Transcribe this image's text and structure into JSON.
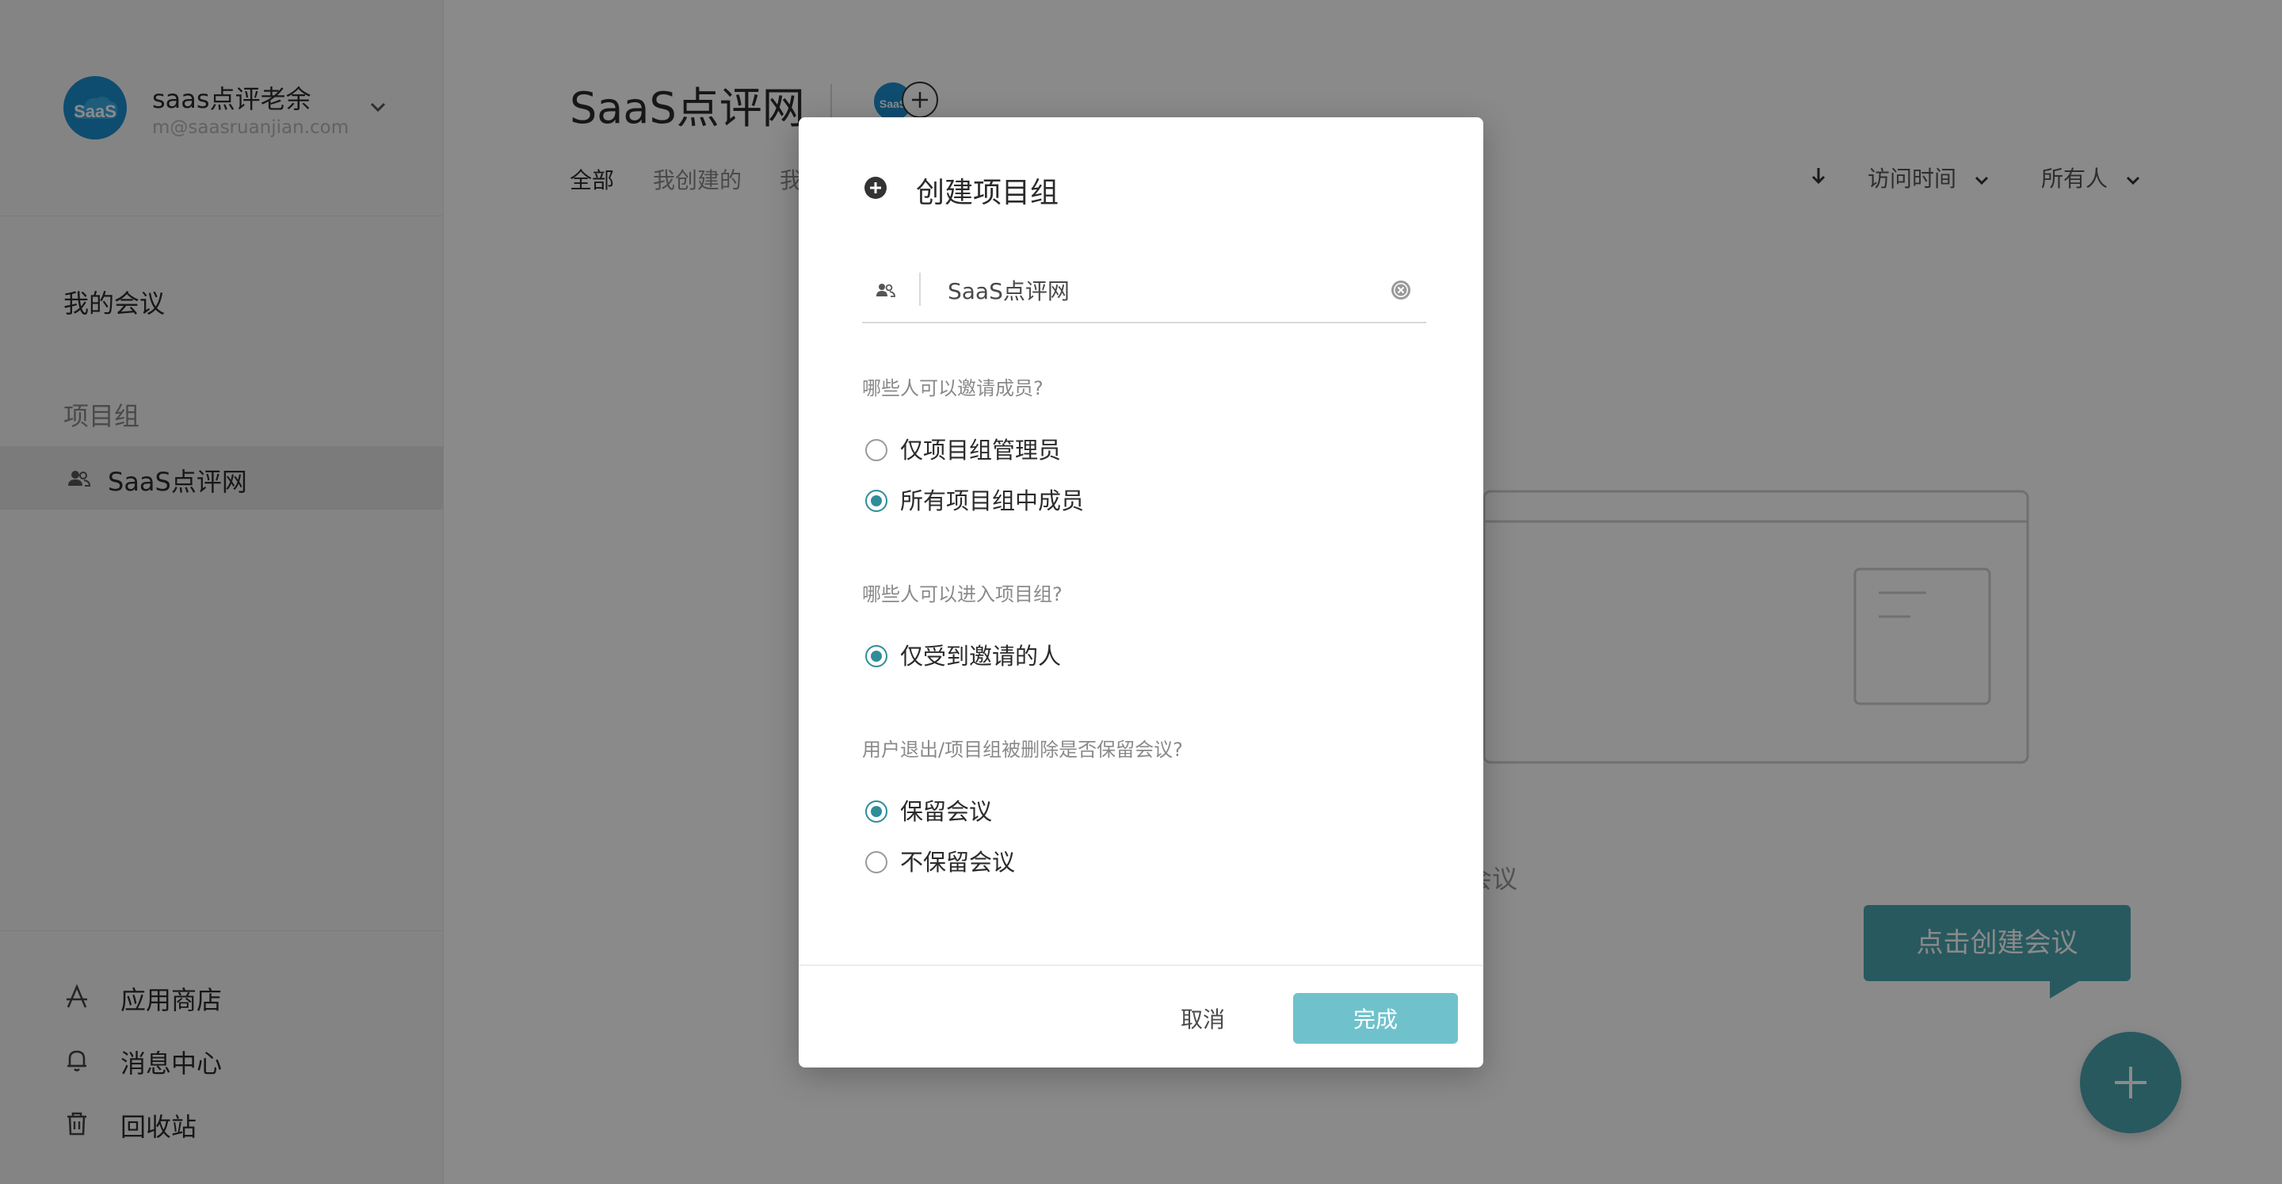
{
  "sidebar": {
    "user": {
      "name": "saas点评老余",
      "email": "m@saasruanjian.com",
      "avatar_text": "SaaS"
    },
    "my_meetings_label": "我的会议",
    "group_section_title": "项目组",
    "group_items": [
      {
        "label": "SaaS点评网",
        "icon": "group-icon"
      }
    ],
    "bottom_items": [
      {
        "label": "应用商店",
        "icon": "app-store-icon"
      },
      {
        "label": "消息中心",
        "icon": "bell-icon"
      },
      {
        "label": "回收站",
        "icon": "trash-icon"
      }
    ]
  },
  "header": {
    "title": "SaaS点评网",
    "badge_text": "SaaS",
    "tabs": [
      {
        "label": "全部",
        "active": true
      },
      {
        "label": "我创建的",
        "active": false
      },
      {
        "label": "我",
        "active": false
      }
    ],
    "sort_icon": "arrow-down-icon",
    "filters": [
      {
        "label": "访问时间"
      },
      {
        "label": "所有人"
      }
    ]
  },
  "main": {
    "empty_text_partial": "会议",
    "tooltip_text": "点击创建会议"
  },
  "modal": {
    "title": "创建项目组",
    "name_input": {
      "value": "SaaS点评网",
      "placeholder": ""
    },
    "sections": [
      {
        "question": "哪些人可以邀请成员?",
        "options": [
          {
            "label": "仅项目组管理员",
            "checked": false
          },
          {
            "label": "所有项目组中成员",
            "checked": true
          }
        ]
      },
      {
        "question": "哪些人可以进入项目组?",
        "options": [
          {
            "label": "仅受到邀请的人",
            "checked": true
          }
        ]
      },
      {
        "question": "用户退出/项目组被删除是否保留会议?",
        "options": [
          {
            "label": "保留会议",
            "checked": true
          },
          {
            "label": "不保留会议",
            "checked": false
          }
        ]
      }
    ],
    "cancel_label": "取消",
    "done_label": "完成"
  },
  "colors": {
    "accent": "#4aa5b0",
    "radio_checked": "#2f8d99",
    "done_button": "#6fc2cc",
    "overlay": "rgba(0,0,0,0.46)"
  }
}
